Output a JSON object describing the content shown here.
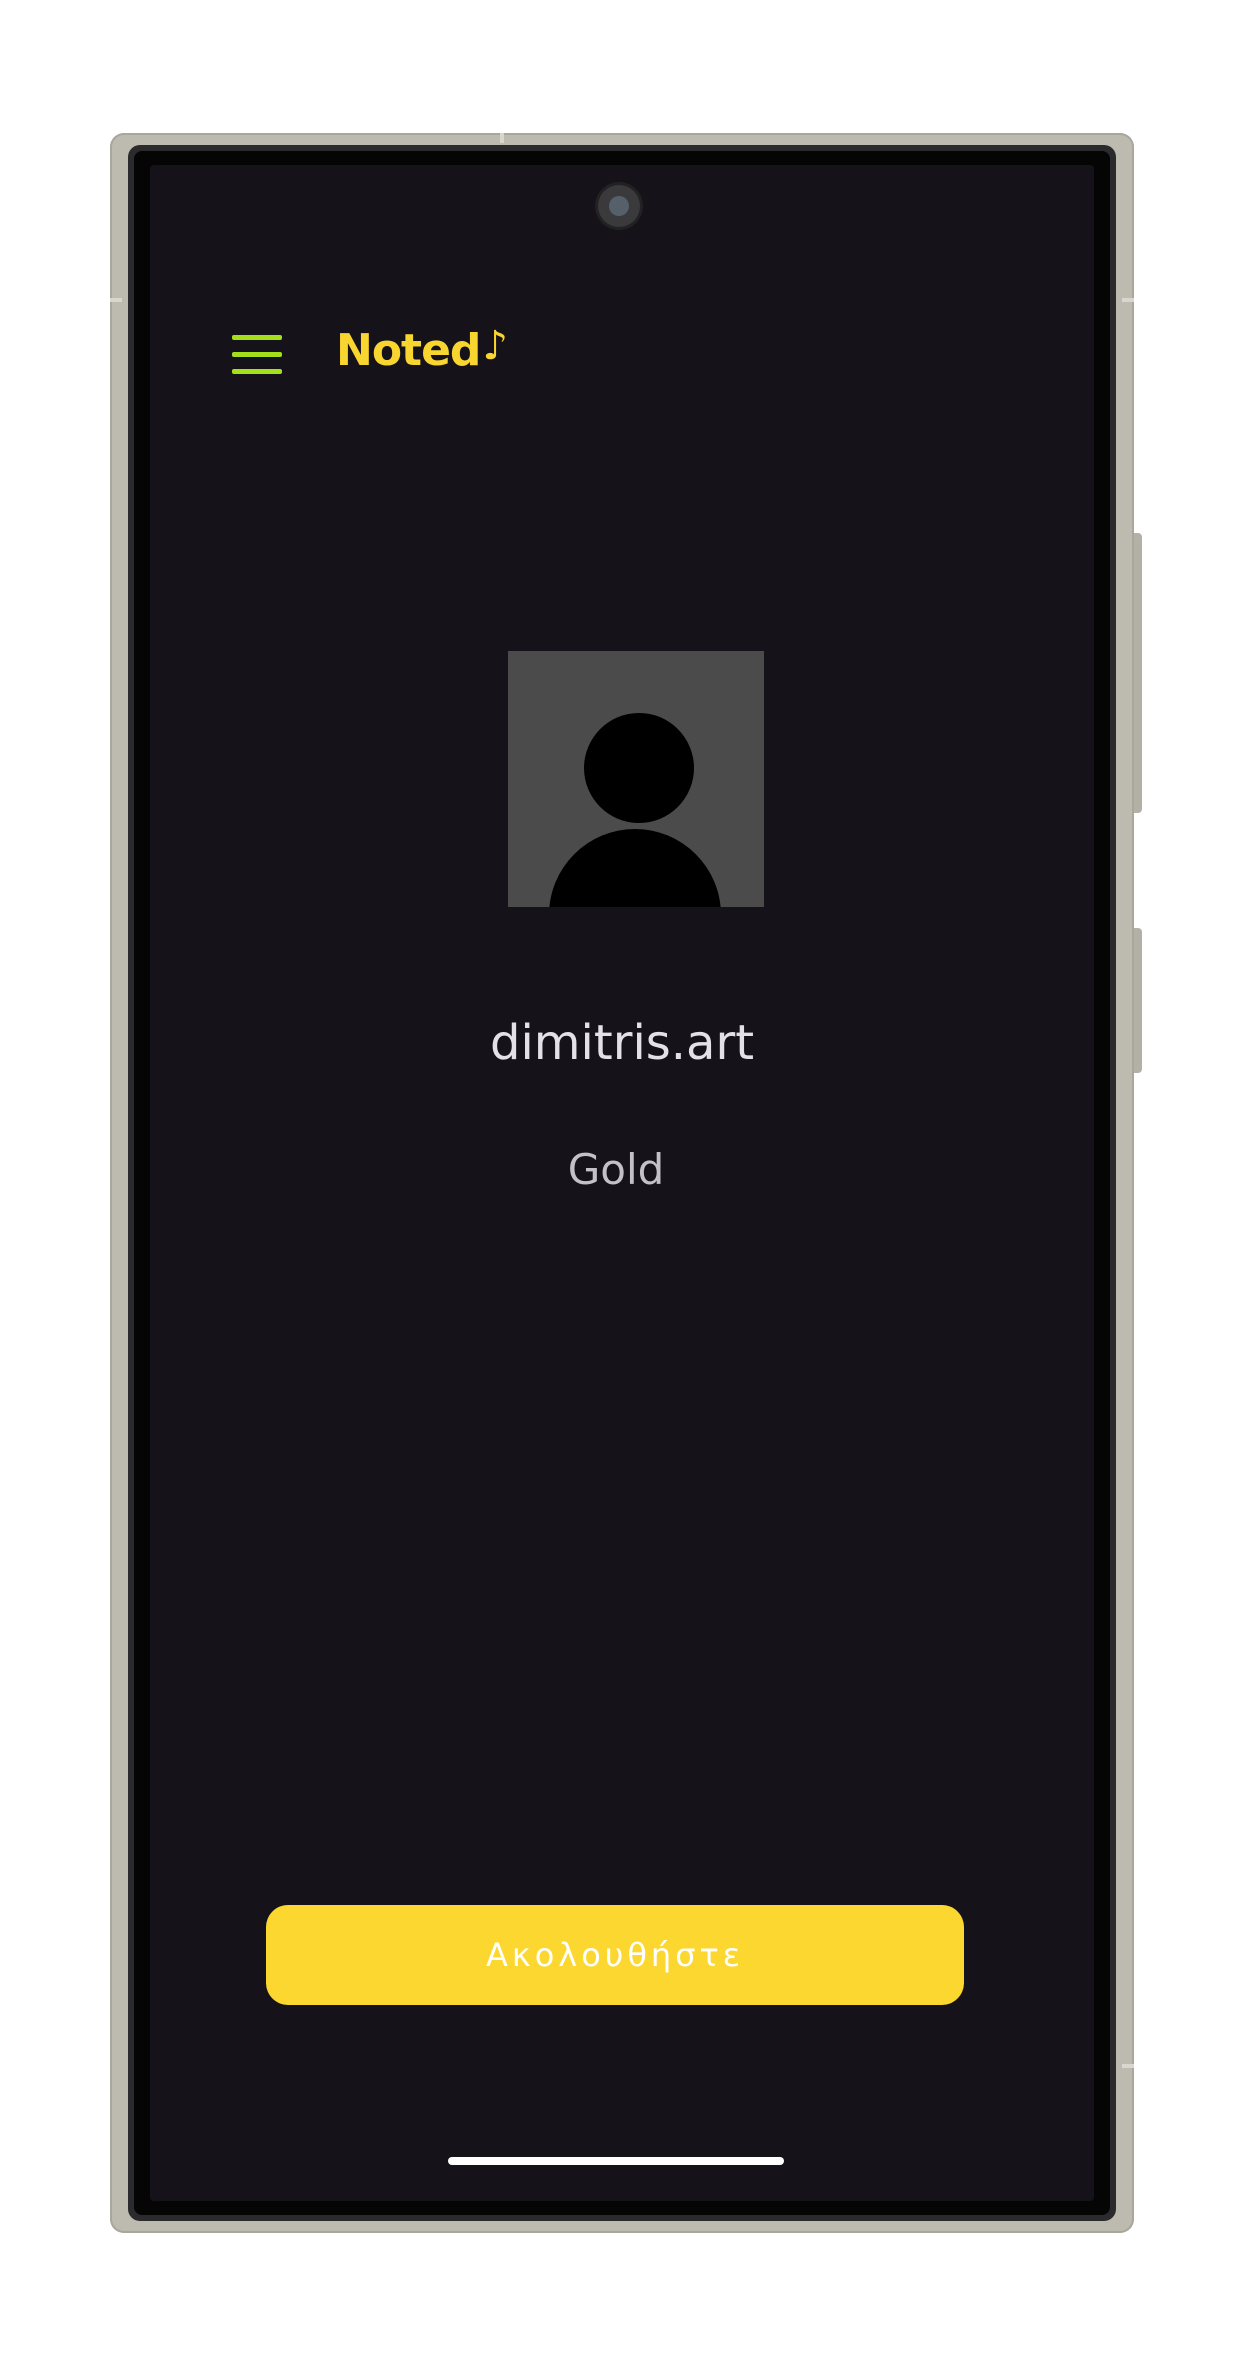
{
  "app": {
    "brand_name": "Noted",
    "brand_glyph": "♪",
    "accent_color": "#f9d530",
    "menu_icon_color": "#a3e01a",
    "screen_background": "#15121a"
  },
  "header": {
    "menu_icon": "hamburger-menu-icon"
  },
  "profile": {
    "avatar_icon": "default-user-avatar-icon",
    "username": "dimitris.art",
    "tier": "Gold"
  },
  "actions": {
    "follow_label": "Ακολουθήστε",
    "follow_button_color": "#fcd730"
  }
}
